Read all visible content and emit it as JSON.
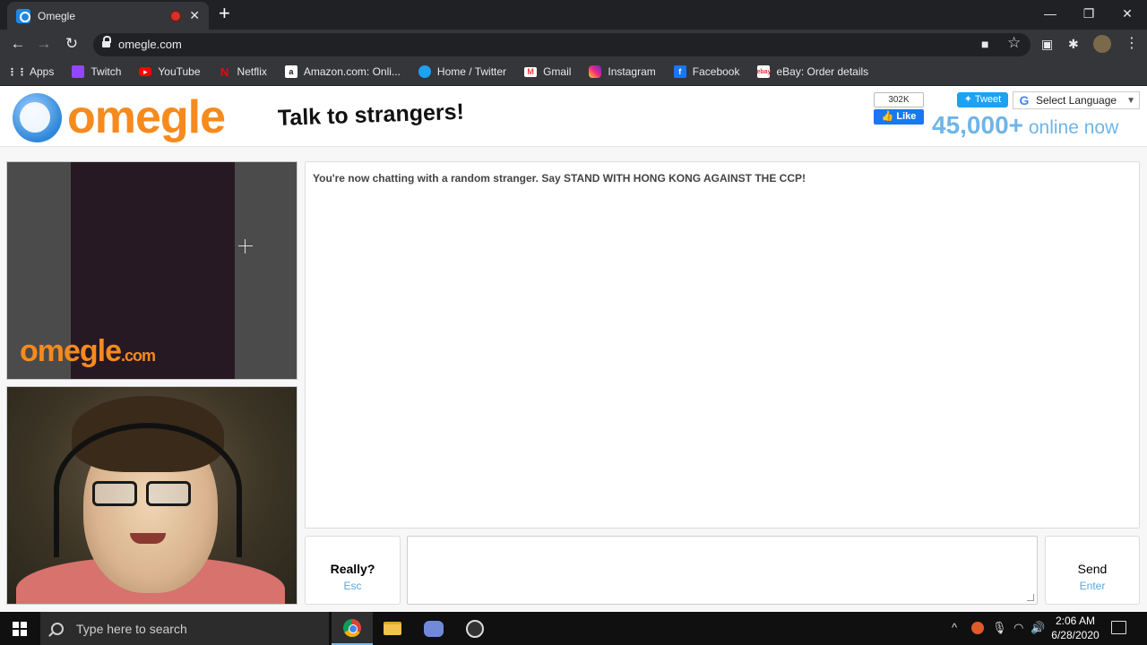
{
  "browser": {
    "tab_title": "Omegle",
    "tab_close": "✕",
    "new_tab": "+",
    "url": "omegle.com",
    "window_controls": {
      "minimize": "—",
      "restore": "❐",
      "close": "✕"
    },
    "nav": {
      "back": "←",
      "forward": "→",
      "reload": "↻"
    },
    "toolbar_icons": {
      "camera": "■",
      "star": "☆",
      "extension": "▣",
      "puzzle": "✱",
      "menu": "⋮"
    }
  },
  "bookmarks": [
    {
      "label": "Apps",
      "icon": "apps-icon",
      "color": "#e8eaed"
    },
    {
      "label": "Twitch",
      "icon": "twitch-icon",
      "color": "#9146ff"
    },
    {
      "label": "YouTube",
      "icon": "youtube-icon",
      "color": "#ff0000"
    },
    {
      "label": "Netflix",
      "icon": "netflix-icon",
      "color": "#e50914"
    },
    {
      "label": "Amazon.com: Onli...",
      "icon": "amazon-icon",
      "color": "#ffffff"
    },
    {
      "label": "Home / Twitter",
      "icon": "twitter-icon",
      "color": "#1da1f2"
    },
    {
      "label": "Gmail",
      "icon": "gmail-icon",
      "color": "#ea4335"
    },
    {
      "label": "Instagram",
      "icon": "instagram-icon",
      "color": "#e1306c"
    },
    {
      "label": "Facebook",
      "icon": "facebook-icon",
      "color": "#1877f2"
    },
    {
      "label": "eBay: Order details",
      "icon": "ebay-icon",
      "color": "#ffffff"
    }
  ],
  "header": {
    "logo_text": "omegle",
    "tagline": "Talk to strangers!",
    "fb_count": "302K",
    "fb_like": "Like",
    "tweet": "Tweet",
    "language": "Select Language",
    "language_arrow": "▼",
    "online_count": "45,000+",
    "online_label": " online now"
  },
  "video": {
    "watermark": "omegle",
    "watermark_suffix": ".com"
  },
  "chat": {
    "log_message": "You're now chatting with a random stranger. Say STAND WITH HONG KONG AGAINST THE CCP!",
    "disconnect_label": "Really?",
    "disconnect_key": "Esc",
    "send_label": "Send",
    "send_key": "Enter"
  },
  "taskbar": {
    "search_placeholder": "Type here to search",
    "time": "2:06 AM",
    "date": "6/28/2020",
    "tray": {
      "chevron": "^",
      "volume": "🔊",
      "wifi": "◠",
      "mic": "🎙"
    }
  },
  "colors": {
    "omegle_orange": "#f78a1d",
    "omegle_blue": "#6fb5e8",
    "chrome_dark": "#35363a"
  }
}
